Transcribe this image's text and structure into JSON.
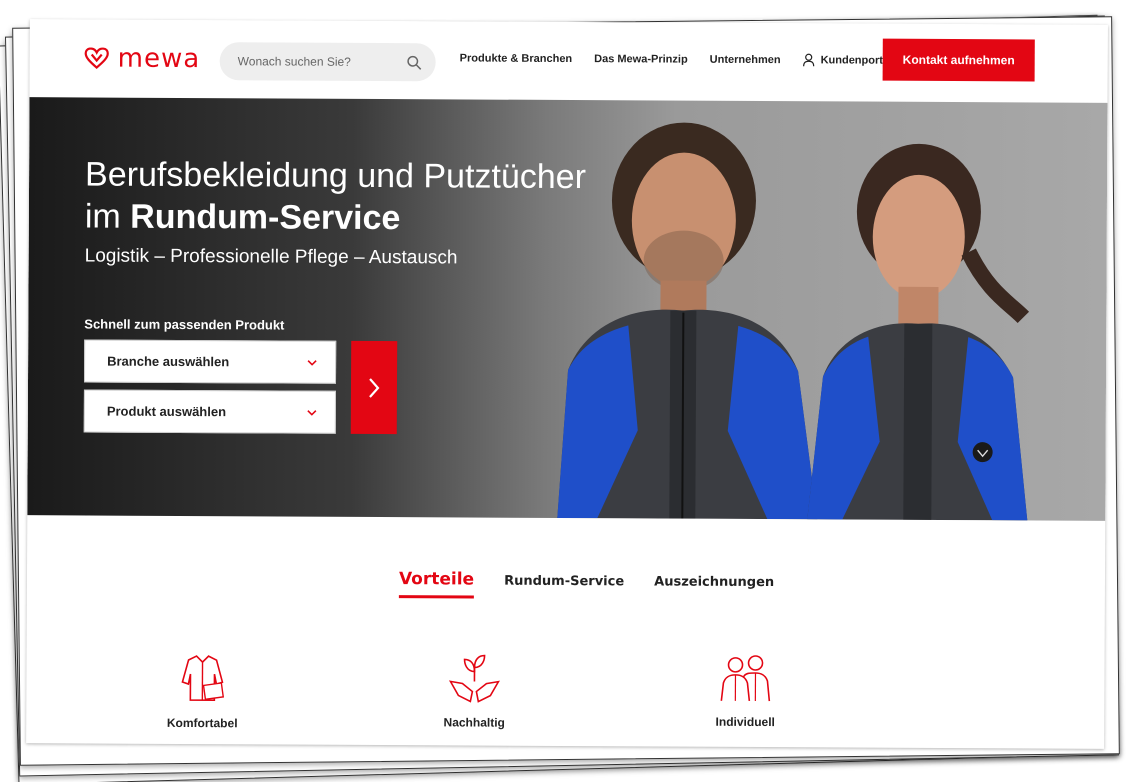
{
  "brand": {
    "name": "mewa",
    "color": "#e30613"
  },
  "search": {
    "placeholder": "Wonach suchen Sie?",
    "icon": "search-icon"
  },
  "nav": {
    "items": [
      {
        "label": "Produkte & Branchen"
      },
      {
        "label": "Das Mewa-Prinzip"
      },
      {
        "label": "Unternehmen"
      },
      {
        "label": "Kundenportal",
        "icon": "user-icon"
      }
    ],
    "cta_label": "Kontakt aufnehmen"
  },
  "hero": {
    "title_line1": "Berufsbekleidung und Putztücher",
    "title_line2_prefix": "im ",
    "title_line2_bold": "Rundum-Service",
    "subtitle": "Logistik – Professionelle Pflege – Austausch",
    "quick_label": "Schnell zum passenden Produkt",
    "select_branche": "Branche auswählen",
    "select_produkt": "Produkt auswählen"
  },
  "tabs": [
    {
      "label": "Vorteile",
      "active": true
    },
    {
      "label": "Rundum-Service",
      "active": false
    },
    {
      "label": "Auszeichnungen",
      "active": false
    }
  ],
  "features": [
    {
      "label": "Komfortabel",
      "icon": "jacket-icon"
    },
    {
      "label": "Nachhaltig",
      "icon": "hands-plant-icon"
    },
    {
      "label": "Individuell",
      "icon": "people-icon"
    }
  ]
}
